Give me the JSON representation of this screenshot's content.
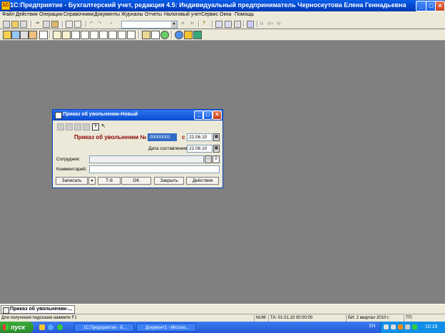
{
  "app": {
    "title": "1С:Предприятие - Бухгалтерский учет, редакция 4.5: Индивидуальный предприниматель Черноскутова Елена Геннадьевна"
  },
  "menu": [
    "Файл",
    "Действия",
    "Операции",
    "Справочники",
    "Документы",
    "Журналы",
    "Отчеты",
    "Налоговый учет",
    "Сервис",
    "Окна",
    "Помощь"
  ],
  "toolbar": {
    "m_label": "M",
    "m_plus_label": "M+",
    "m_minus_label": "M-"
  },
  "dialog": {
    "title": "Приказ об увольнении-Новый",
    "heading": "Приказ об увольнении №",
    "number": "00000001",
    "from_label": "с",
    "from_date": "22.06.10",
    "compiled_label": "Дата составления",
    "compiled_date": "22.06.10",
    "employee_label": "Сотрудник:",
    "employee_value": "",
    "comment_label": "Комментарий:",
    "comment_value": "",
    "buttons": {
      "write": "Записать",
      "t8": "Т-8",
      "ok": "OK",
      "close": "Закрыть",
      "actions": "Действия"
    }
  },
  "window_tab": "Приказ об увольнении-...",
  "status": {
    "hint": "Для получения подсказки нажмите F1",
    "num": "NUM",
    "ta": "ТА: 01.01.10  00:00:00",
    "bi": "БИ: 2 квартал 2010 г.",
    "tp": "ТП:"
  },
  "taskbar": {
    "start": "пуск",
    "task1": "1С:Предприятие - Б...",
    "task2": "Документ1 - Microso...",
    "lang": "EN",
    "time": "10:15"
  },
  "colors": {
    "titlebar": "#0044cc",
    "heading_text": "#8b0000",
    "number_highlight": "#316ac5",
    "desktop": "#808080"
  }
}
